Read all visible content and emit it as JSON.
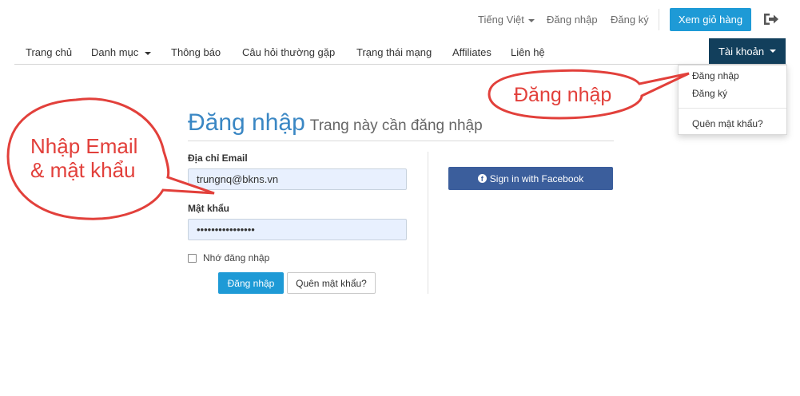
{
  "topbar": {
    "language": "Tiếng Việt",
    "login": "Đăng nhập",
    "register": "Đăng ký",
    "cart_button": "Xem giỏ hàng"
  },
  "nav": {
    "items": [
      {
        "label": "Trang chủ"
      },
      {
        "label": "Danh mục"
      },
      {
        "label": "Thông báo"
      },
      {
        "label": "Câu hỏi thường gặp"
      },
      {
        "label": "Trạng thái mạng"
      },
      {
        "label": "Affiliates"
      },
      {
        "label": "Liên hệ"
      }
    ],
    "account": "Tài khoản"
  },
  "dropdown": {
    "login": "Đăng nhập",
    "register": "Đăng ký",
    "forgot": "Quên mật khẩu?"
  },
  "page": {
    "title": "Đăng nhập",
    "subtitle": "Trang này cần đăng nhập"
  },
  "form": {
    "email_label": "Địa chỉ Email",
    "email_value": "trungnq@bkns.vn",
    "password_label": "Mật khẩu",
    "password_value": "••••••••••••••••",
    "remember_label": "Nhớ đăng nhập",
    "login_button": "Đăng nhập",
    "forgot_button": "Quên mật khẩu?",
    "facebook_button": "Sign in with Facebook"
  },
  "callouts": {
    "left_line1": "Nhập Email",
    "left_line2": "& mật khẩu",
    "right": "Đăng nhập"
  },
  "colors": {
    "accent": "#1e9ad6",
    "account_bg": "#123f5c",
    "facebook": "#3b5e9c",
    "callout": "#e2403b",
    "input_bg": "#e8f0fe"
  }
}
